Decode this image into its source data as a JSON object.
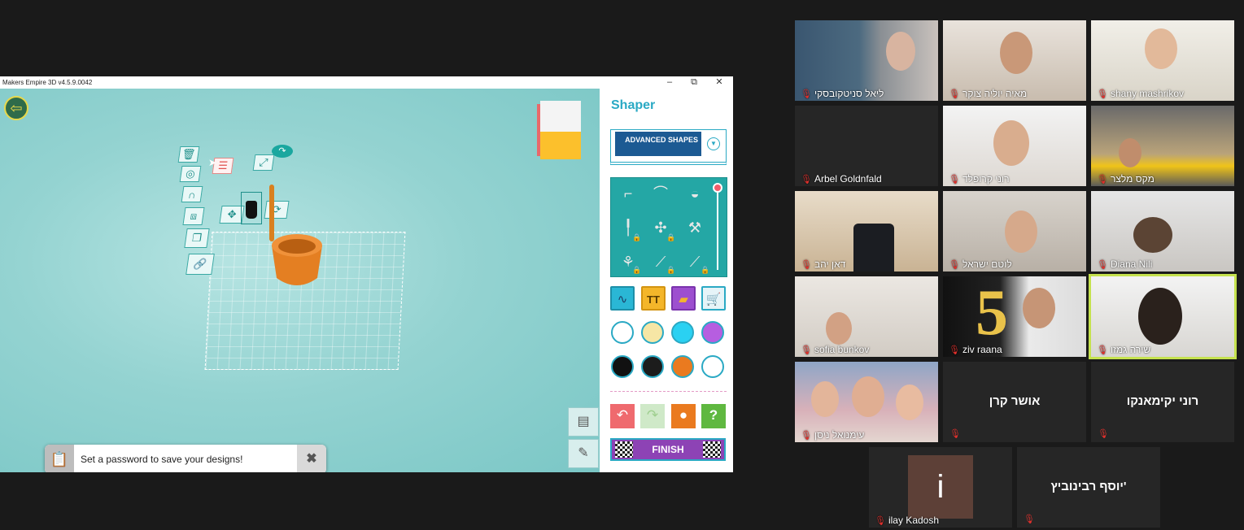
{
  "app": {
    "title": "Makers Empire 3D v4.5.9.0042",
    "window_controls": {
      "minimize": "–",
      "maximize": "⧉",
      "close": "✕"
    }
  },
  "toast": {
    "message": "Set a password to save your designs!",
    "close": "✖"
  },
  "shaper": {
    "title": "Shaper",
    "shape_category": "ADVANCED SHAPES",
    "finish_label": "FINISH",
    "colors": [
      "#ffffff",
      "#f6e6a5",
      "#2ad1f2",
      "#b65ee0",
      "#111111",
      "#1c1c1c",
      "#ea7a1f",
      "#ffffff"
    ]
  },
  "participants": [
    {
      "name": "ליאל סניטקובסקי",
      "muted": true
    },
    {
      "name": "מאיה יוליה צוקר",
      "muted": true
    },
    {
      "name": "shany mashrikov",
      "muted": true
    },
    {
      "name": "Arbel Goldnfald",
      "muted": true
    },
    {
      "name": "רוני קרופלד",
      "muted": true
    },
    {
      "name": "מקס מלצר",
      "muted": true
    },
    {
      "name": "דאן יהב",
      "muted": true
    },
    {
      "name": "לוטם ישראל",
      "muted": true
    },
    {
      "name": "Diana Nili",
      "muted": true
    },
    {
      "name": "sofia bunkov",
      "muted": true
    },
    {
      "name": "ziv raana",
      "muted": true
    },
    {
      "name": "שירה גמזו",
      "muted": true
    },
    {
      "name": "עימנואל ניסן",
      "muted": true
    },
    {
      "name": "אושר קרן",
      "muted": true
    },
    {
      "name": "רוני יקימאנקו",
      "muted": true
    },
    {
      "name": "ilay Kadosh",
      "muted": true,
      "avatar_letter": "i"
    },
    {
      "name": "יוסף רבינוביץ'",
      "muted": true
    }
  ]
}
